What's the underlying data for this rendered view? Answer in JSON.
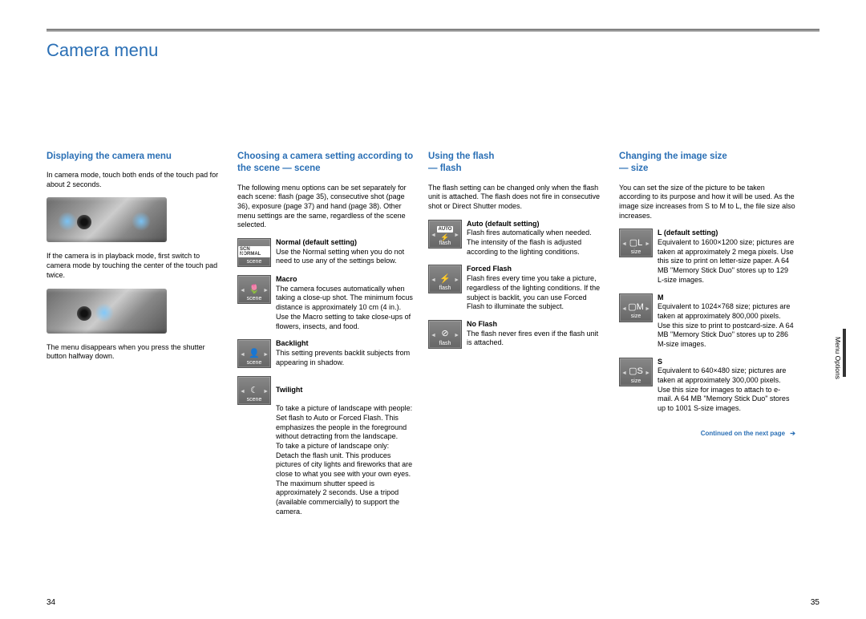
{
  "pageTitle": "Camera menu",
  "leftPageNumber": "34",
  "rightPageNumber": "35",
  "sideLabel": "Menu Options",
  "continuedText": "Continued on the next page",
  "col1": {
    "heading": "Displaying the camera menu",
    "p1": "In camera mode, touch both ends of the touch pad for about 2 seconds.",
    "p2": "If the camera is in playback mode, first switch to camera mode by touching the center of the touch pad twice.",
    "p3": "The menu disappears when you press the shutter button halfway down."
  },
  "col2": {
    "heading": "Choosing a camera setting according to the scene — scene",
    "intro": "The following menu options can be set separately for each scene: flash (page 35), consecutive shot (page 36), exposure (page 37) and hand (page 38). Other menu settings are the same, regardless of the scene selected.",
    "options": [
      {
        "iconCaption": "scene",
        "badge": "SCN NORMAL",
        "title": "Normal (default setting)",
        "body": "Use the Normal setting when you do not need to use any of the settings below."
      },
      {
        "iconCaption": "scene",
        "sym": "🌷",
        "title": "Macro",
        "body": "The camera focuses automatically when taking a close-up shot. The minimum focus distance is approximately 10 cm (4 in.). Use the Macro setting to take close-ups of flowers, insects, and food."
      },
      {
        "iconCaption": "scene",
        "sym": "👤",
        "title": "Backlight",
        "body": "This setting prevents backlit subjects from appearing in shadow."
      },
      {
        "iconCaption": "scene",
        "sym": "☾",
        "title": "Twilight",
        "body": "To take a picture of landscape with people:\nSet flash to Auto or Forced Flash. This emphasizes the people in the foreground without detracting from the landscape.\nTo take a picture of landscape only:\nDetach the flash unit. This produces pictures of city lights and fireworks that are close to what you see with your own eyes. The maximum shutter speed is approximately 2 seconds. Use a tripod (available commercially) to support the camera."
      }
    ]
  },
  "col3": {
    "heading": "Using the flash\n— flash",
    "intro": "The flash setting can be changed only when the flash unit is attached. The flash does not fire in consecutive shot or Direct Shutter modes.",
    "options": [
      {
        "iconCaption": "flash",
        "badge": "AUTO",
        "sym": "⚡",
        "title": "Auto (default setting)",
        "body": "Flash fires automatically when needed. The intensity of the flash is adjusted according to the lighting conditions."
      },
      {
        "iconCaption": "flash",
        "sym": "⚡",
        "title": "Forced Flash",
        "body": "Flash fires every time you take a picture, regardless of the lighting conditions. If the subject is backlit, you can use Forced Flash to illuminate the subject."
      },
      {
        "iconCaption": "flash",
        "sym": "⊘",
        "title": "No Flash",
        "body": "The flash never fires even if the flash unit is attached."
      }
    ]
  },
  "col4": {
    "heading": "Changing the image size\n— size",
    "intro": "You can set the size of the picture to be taken according to its purpose and how it will be used. As the image size increases from S to M to L, the file size also increases.",
    "options": [
      {
        "iconCaption": "size",
        "sym": "▢L",
        "title": "L (default setting)",
        "body": "Equivalent to 1600×1200 size; pictures are taken at approximately 2 mega pixels. Use this size to print on letter-size paper. A 64 MB \"Memory Stick Duo\" stores up to 129 L-size images."
      },
      {
        "iconCaption": "size",
        "sym": "▢M",
        "title": "M",
        "body": "Equivalent to 1024×768 size; pictures are taken at approximately 800,000 pixels. Use this size to print to postcard-size. A 64 MB \"Memory Stick Duo\" stores up to 286 M-size images."
      },
      {
        "iconCaption": "size",
        "sym": "▢S",
        "title": "S",
        "body": "Equivalent to 640×480 size; pictures are taken at approximately 300,000 pixels. Use this size for images to attach to e-mail. A 64 MB \"Memory Stick Duo\" stores up to 1001 S-size images."
      }
    ]
  }
}
